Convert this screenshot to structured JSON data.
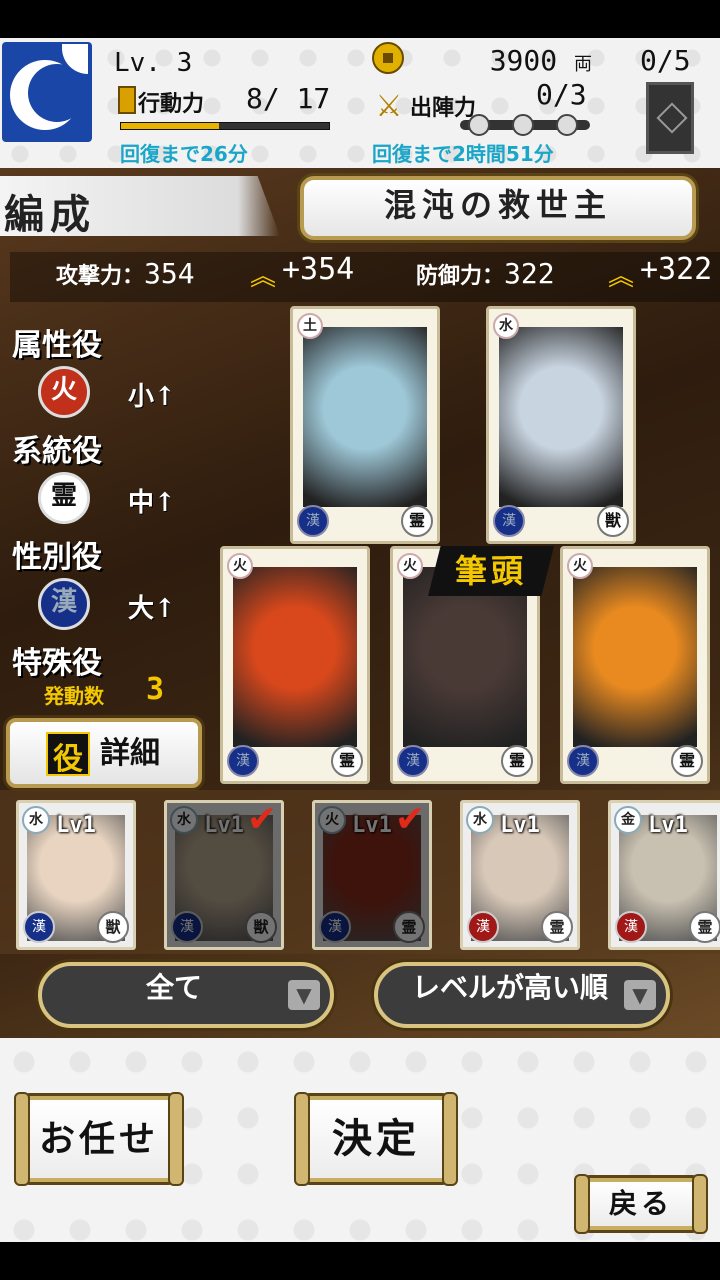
{
  "header": {
    "level": "Lv. 3",
    "ap_label": "行動力",
    "ap_value": "8/ 17",
    "ap_fraction": 0.47,
    "ap_recover": "回復まで26分",
    "money": "3900",
    "money_unit": "両",
    "sortie_label": "出陣力",
    "sortie_value": "0/3",
    "sortie_recover": "回復まで2時間51分",
    "deck_count": "0/5"
  },
  "formation": {
    "tab_label": "編成",
    "deck_name": "混沌の救世主",
    "attack_label": "攻撃力：",
    "attack_value": "354",
    "attack_bonus": "+354",
    "defense_label": "防御力：",
    "defense_value": "322",
    "defense_bonus": "+322"
  },
  "roles": {
    "attribute_title": "属性役",
    "attribute_icon": "火",
    "attribute_level": "小",
    "lineage_title": "系統役",
    "lineage_icon": "霊",
    "lineage_level": "中",
    "gender_title": "性別役",
    "gender_icon": "漢",
    "gender_level": "大",
    "special_title": "特殊役",
    "activate_label": "発動数",
    "activate_count": "3",
    "detail_badge": "役",
    "detail_label": "詳細"
  },
  "cards": [
    {
      "element": "土",
      "class": "漢",
      "race": "霊",
      "palette": "#9ec8d8"
    },
    {
      "element": "水",
      "class": "漢",
      "race": "獣",
      "palette": "#c8d4e0"
    },
    {
      "element": "火",
      "class": "漢",
      "race": "霊",
      "palette": "#d8481c"
    },
    {
      "element": "火",
      "class": "漢",
      "race": "霊",
      "palette": "#4a3a36"
    },
    {
      "element": "火",
      "class": "漢",
      "race": "霊",
      "palette": "#e88a20"
    }
  ],
  "leader_tag": "筆頭",
  "bench": [
    {
      "element": "水",
      "lv": "Lv1",
      "race": "獣",
      "selected": false,
      "palette": "#e8d4c0"
    },
    {
      "element": "水",
      "lv": "Lv1",
      "race": "獣",
      "selected": true,
      "palette": "#b8a890"
    },
    {
      "element": "火",
      "lv": "Lv1",
      "race": "霊",
      "selected": true,
      "palette": "#8a2a1a"
    },
    {
      "element": "水",
      "lv": "Lv1",
      "race": "霊",
      "selected": false,
      "palette": "#d8c8b8"
    },
    {
      "element": "金",
      "lv": "Lv1",
      "race": "霊",
      "selected": false,
      "palette": "#c8c0b0"
    }
  ],
  "filters": {
    "type_label": "全て",
    "sort_label": "レベルが高い順"
  },
  "buttons": {
    "auto_label": "お任せ",
    "confirm_label": "決定",
    "back_label": "戻る"
  },
  "colors": {
    "accent": "#f4c800",
    "recover_text": "#1aa6c8",
    "check": "#e02a1a"
  }
}
